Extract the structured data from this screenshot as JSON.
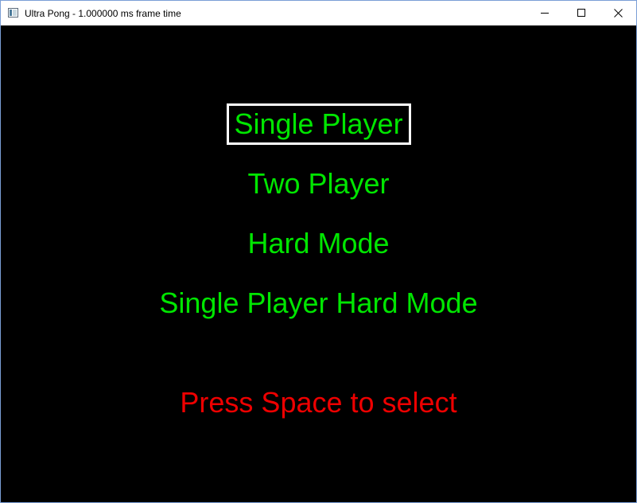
{
  "window": {
    "title": "Ultra Pong - 1.000000 ms frame time",
    "icon": "app-window-icon",
    "controls": {
      "minimize_icon": "minimize-icon",
      "maximize_icon": "maximize-icon",
      "close_icon": "close-icon"
    }
  },
  "game": {
    "background_color": "#000000",
    "menu": {
      "item_color": "#00e600",
      "selection_border_color": "#ffffff",
      "selected_index": 0,
      "items": [
        {
          "label": "Single Player"
        },
        {
          "label": "Two Player"
        },
        {
          "label": "Hard Mode"
        },
        {
          "label": "Single Player Hard Mode"
        }
      ]
    },
    "prompt": {
      "text": "Press Space to select",
      "color": "#ee0000"
    }
  }
}
